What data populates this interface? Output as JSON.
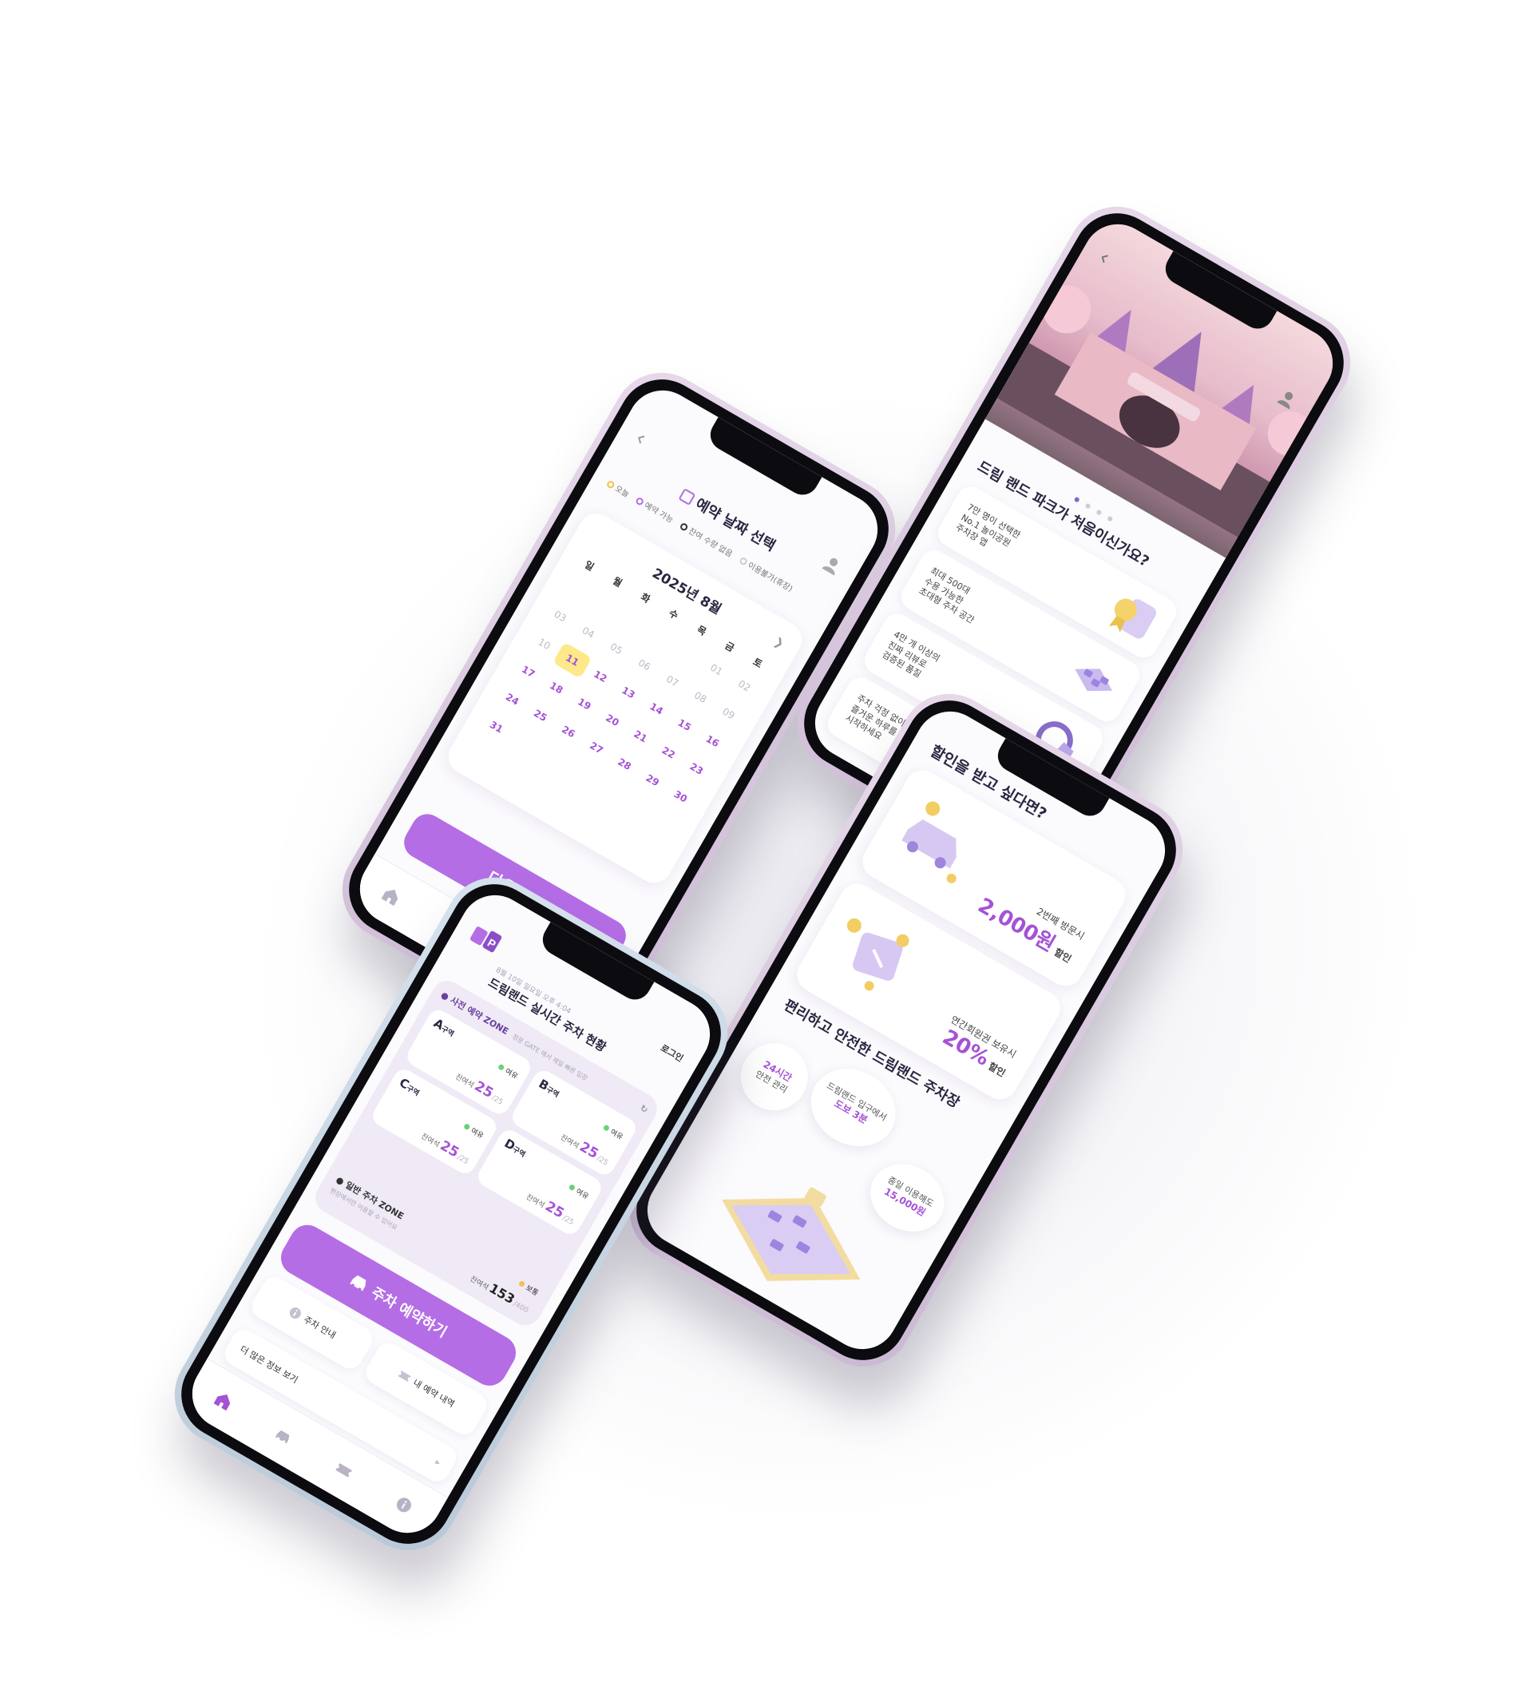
{
  "colors": {
    "accent": "#b56de6",
    "accent_text": "#a552d6",
    "selected_day": "#fde98a",
    "available_dot": "#6bd07a",
    "normal_dot": "#f4c24e"
  },
  "calendar_screen": {
    "title": "예약 날짜 선택",
    "legend": [
      "오늘",
      "예약 가능",
      "잔여 수량 없음",
      "이용불가(휴장)"
    ],
    "month_label": "2025년 8월",
    "next_month_icon": "chevron-right-icon",
    "weekdays": [
      "일",
      "월",
      "화",
      "수",
      "목",
      "금",
      "토"
    ],
    "weeks": [
      [
        {
          "d": "",
          "s": ""
        },
        {
          "d": "",
          "s": ""
        },
        {
          "d": "",
          "s": ""
        },
        {
          "d": "",
          "s": ""
        },
        {
          "d": "",
          "s": ""
        },
        {
          "d": "01",
          "s": "dis"
        },
        {
          "d": "02",
          "s": "dis"
        }
      ],
      [
        {
          "d": "03",
          "s": "dis"
        },
        {
          "d": "04",
          "s": "dis"
        },
        {
          "d": "05",
          "s": "dis"
        },
        {
          "d": "06",
          "s": "dis"
        },
        {
          "d": "07",
          "s": "dis"
        },
        {
          "d": "08",
          "s": "dis"
        },
        {
          "d": "09",
          "s": "dis"
        }
      ],
      [
        {
          "d": "10",
          "s": "dis"
        },
        {
          "d": "11",
          "s": "sel"
        },
        {
          "d": "12",
          "s": "av"
        },
        {
          "d": "13",
          "s": "av"
        },
        {
          "d": "14",
          "s": "av"
        },
        {
          "d": "15",
          "s": "av"
        },
        {
          "d": "16",
          "s": "av"
        }
      ],
      [
        {
          "d": "17",
          "s": "av"
        },
        {
          "d": "18",
          "s": "av"
        },
        {
          "d": "19",
          "s": "av"
        },
        {
          "d": "20",
          "s": "av"
        },
        {
          "d": "21",
          "s": "av"
        },
        {
          "d": "22",
          "s": "av"
        },
        {
          "d": "23",
          "s": "av"
        }
      ],
      [
        {
          "d": "24",
          "s": "av"
        },
        {
          "d": "25",
          "s": "av"
        },
        {
          "d": "26",
          "s": "av"
        },
        {
          "d": "27",
          "s": "av"
        },
        {
          "d": "28",
          "s": "av"
        },
        {
          "d": "29",
          "s": "av"
        },
        {
          "d": "30",
          "s": "av"
        }
      ],
      [
        {
          "d": "31",
          "s": "av"
        },
        {
          "d": "",
          "s": ""
        },
        {
          "d": "",
          "s": ""
        },
        {
          "d": "",
          "s": ""
        },
        {
          "d": "",
          "s": ""
        },
        {
          "d": "",
          "s": ""
        },
        {
          "d": "",
          "s": ""
        }
      ]
    ],
    "next_button": "다음으로"
  },
  "onboarding_screen": {
    "title": "드림 랜드 파크가 처음이신가요?",
    "features": [
      {
        "text": "7만 명이 선택한\nNo.1 놀이공원\n주차장 앱",
        "icon": "award-badge-icon"
      },
      {
        "text": "최대 500대\n수용 가능한\n초대형 주차 공간",
        "icon": "parking-lot-icon"
      },
      {
        "text": "4만 개 이상의\n진짜 리뷰로\n검증된 품질",
        "icon": "review-shield-icon"
      },
      {
        "text": "주차 걱정 없이\n즐거운 하루를\n시작하세요",
        "icon": "carousel-icon"
      }
    ]
  },
  "discount_screen": {
    "title": "할인을 받고 싶다면?",
    "cards": [
      {
        "caption": "2번째 방문시",
        "amount": "2,000원",
        "unit": "할인",
        "icon": "car-coins-icon"
      },
      {
        "caption": "연간회원권 보유시",
        "amount": "20%",
        "unit": "할인",
        "icon": "ticket-coins-icon"
      }
    ],
    "subtitle": "편리하고 안전한 드림랜드 주차장",
    "bubbles": [
      {
        "line1": "24시간",
        "line2": "안전 관리"
      },
      {
        "line1": "드림랜드 입구에서",
        "line2": "도보 3분"
      },
      {
        "line1": "종일 이용해도",
        "line2": "15,000원"
      }
    ]
  },
  "home_screen": {
    "login": "로그인",
    "date": "8월 10일 일요일 오후 4:04",
    "title": "드림랜드 실시간 주차 현황",
    "prebook_zone": {
      "label": "사전 예약 ZONE",
      "note": "정문 GATE 에서 제일 빠른 입장"
    },
    "zones": [
      {
        "name": "A",
        "suffix": "구역",
        "status": "여유",
        "remain_label": "잔여석",
        "remain": "25",
        "total": "/25"
      },
      {
        "name": "B",
        "suffix": "구역",
        "status": "여유",
        "remain_label": "잔여석",
        "remain": "25",
        "total": "/25"
      },
      {
        "name": "C",
        "suffix": "구역",
        "status": "여유",
        "remain_label": "잔여석",
        "remain": "25",
        "total": "/25"
      },
      {
        "name": "D",
        "suffix": "구역",
        "status": "여유",
        "remain_label": "잔여석",
        "remain": "25",
        "total": "/25"
      }
    ],
    "general_zone": {
      "label": "일반 주차 ZONE",
      "note": "현장에서만 이용할 수 있어요",
      "status": "보통",
      "remain_label": "잔여석",
      "remain": "153",
      "total": "/400"
    },
    "reserve_button": "주차 예약하기",
    "menu": [
      "주차 안내",
      "내 예약 내역"
    ],
    "more": "더 많은 정보 보기"
  }
}
